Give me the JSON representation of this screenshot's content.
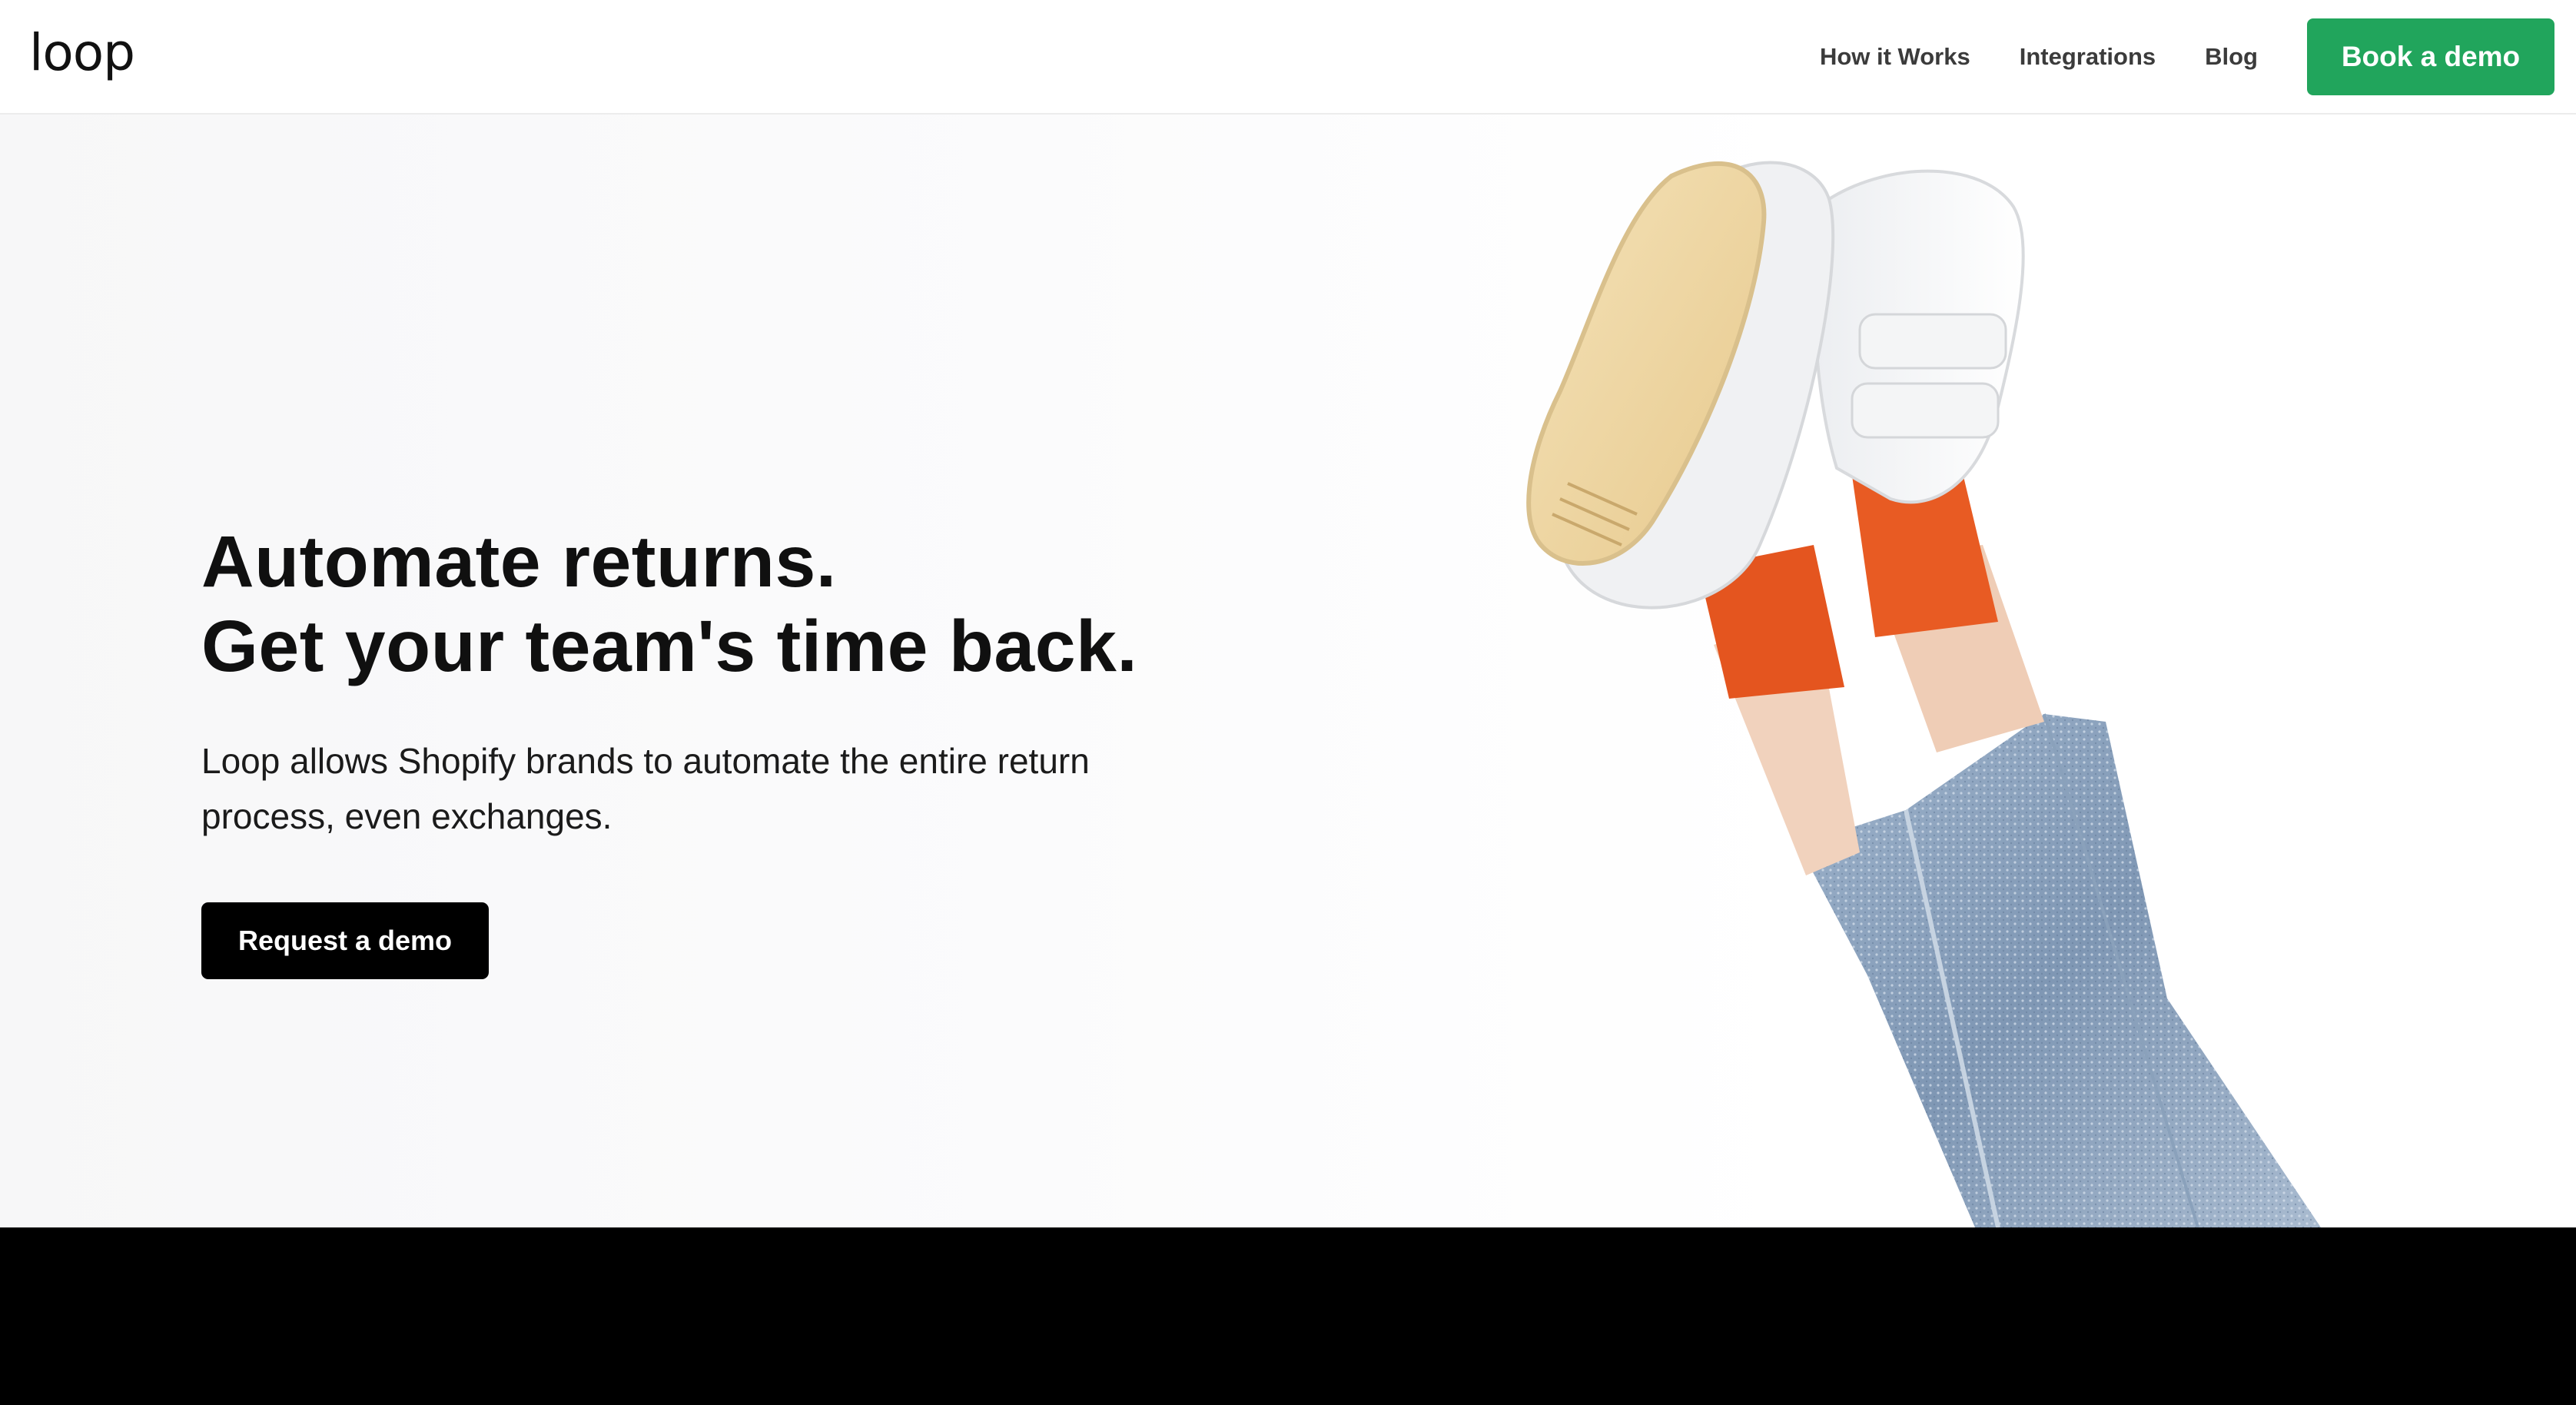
{
  "header": {
    "logo_text": "loop",
    "nav": [
      {
        "label": "How it Works"
      },
      {
        "label": "Integrations"
      },
      {
        "label": "Blog"
      }
    ],
    "cta_label": "Book a demo"
  },
  "hero": {
    "headline_line1": "Automate returns.",
    "headline_line2": "Get your team's time back.",
    "subtext": "Loop allows Shopify brands to automate the entire return process, even exchanges.",
    "cta_label": "Request a demo",
    "image_subject": "legs-in-sneakers-and-orange-socks-photo"
  },
  "colors": {
    "accent_green": "#21a55c",
    "cta_black": "#000000",
    "text_dark": "#101010",
    "footer_band": "#000000"
  }
}
